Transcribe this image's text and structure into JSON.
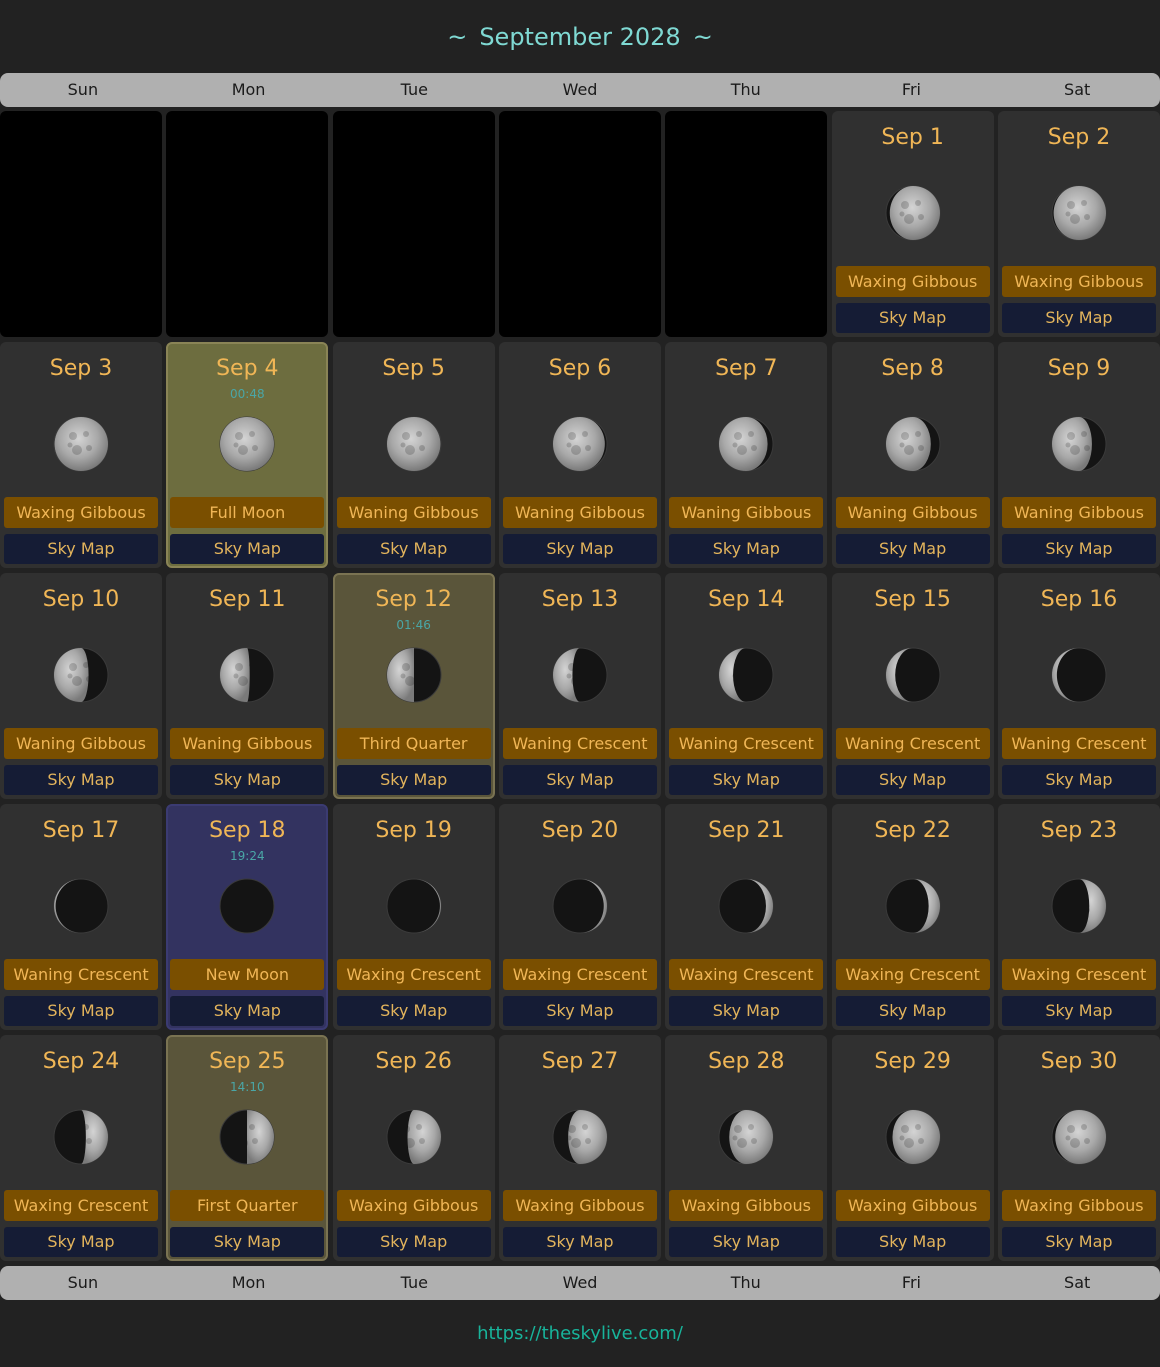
{
  "header": {
    "tilde_left": "~",
    "title": "September 2028",
    "tilde_right": "~"
  },
  "weekdays": [
    "Sun",
    "Mon",
    "Tue",
    "Wed",
    "Thu",
    "Fri",
    "Sat"
  ],
  "first_weekday_index": 5,
  "sky_map_label": "Sky Map",
  "colors": {
    "accent": "#f0b656",
    "title": "#7fd9d3",
    "link": "#18b39a",
    "phase_bg": "#7a4f00",
    "skymap_bg": "#151c35"
  },
  "days": [
    {
      "date": "Sep 1",
      "phase": "Waxing Gibbous",
      "illum": 0.93,
      "waxing": true
    },
    {
      "date": "Sep 2",
      "phase": "Waxing Gibbous",
      "illum": 0.97,
      "waxing": true
    },
    {
      "date": "Sep 3",
      "phase": "Waxing Gibbous",
      "illum": 0.99,
      "waxing": true
    },
    {
      "date": "Sep 4",
      "phase": "Full Moon",
      "time": "00:48",
      "illum": 1.0,
      "waxing": true,
      "highlight": "gold"
    },
    {
      "date": "Sep 5",
      "phase": "Waning Gibbous",
      "illum": 0.99,
      "waxing": false
    },
    {
      "date": "Sep 6",
      "phase": "Waning Gibbous",
      "illum": 0.96,
      "waxing": false
    },
    {
      "date": "Sep 7",
      "phase": "Waning Gibbous",
      "illum": 0.9,
      "waxing": false
    },
    {
      "date": "Sep 8",
      "phase": "Waning Gibbous",
      "illum": 0.83,
      "waxing": false
    },
    {
      "date": "Sep 9",
      "phase": "Waning Gibbous",
      "illum": 0.74,
      "waxing": false
    },
    {
      "date": "Sep 10",
      "phase": "Waning Gibbous",
      "illum": 0.64,
      "waxing": false
    },
    {
      "date": "Sep 11",
      "phase": "Waning Gibbous",
      "illum": 0.55,
      "waxing": false
    },
    {
      "date": "Sep 12",
      "phase": "Third Quarter",
      "time": "01:46",
      "illum": 0.5,
      "waxing": false,
      "highlight": "olive"
    },
    {
      "date": "Sep 13",
      "phase": "Waning Crescent",
      "illum": 0.36,
      "waxing": false
    },
    {
      "date": "Sep 14",
      "phase": "Waning Crescent",
      "illum": 0.26,
      "waxing": false
    },
    {
      "date": "Sep 15",
      "phase": "Waning Crescent",
      "illum": 0.17,
      "waxing": false
    },
    {
      "date": "Sep 16",
      "phase": "Waning Crescent",
      "illum": 0.09,
      "waxing": false
    },
    {
      "date": "Sep 17",
      "phase": "Waning Crescent",
      "illum": 0.03,
      "waxing": false
    },
    {
      "date": "Sep 18",
      "phase": "New Moon",
      "time": "19:24",
      "illum": 0.0,
      "waxing": true,
      "highlight": "blue"
    },
    {
      "date": "Sep 19",
      "phase": "Waxing Crescent",
      "illum": 0.02,
      "waxing": true
    },
    {
      "date": "Sep 20",
      "phase": "Waxing Crescent",
      "illum": 0.06,
      "waxing": true
    },
    {
      "date": "Sep 21",
      "phase": "Waxing Crescent",
      "illum": 0.13,
      "waxing": true
    },
    {
      "date": "Sep 22",
      "phase": "Waxing Crescent",
      "illum": 0.21,
      "waxing": true
    },
    {
      "date": "Sep 23",
      "phase": "Waxing Crescent",
      "illum": 0.31,
      "waxing": true
    },
    {
      "date": "Sep 24",
      "phase": "Waxing Crescent",
      "illum": 0.41,
      "waxing": true
    },
    {
      "date": "Sep 25",
      "phase": "First Quarter",
      "time": "14:10",
      "illum": 0.5,
      "waxing": true,
      "highlight": "olive"
    },
    {
      "date": "Sep 26",
      "phase": "Waxing Gibbous",
      "illum": 0.62,
      "waxing": true
    },
    {
      "date": "Sep 27",
      "phase": "Waxing Gibbous",
      "illum": 0.72,
      "waxing": true
    },
    {
      "date": "Sep 28",
      "phase": "Waxing Gibbous",
      "illum": 0.81,
      "waxing": true
    },
    {
      "date": "Sep 29",
      "phase": "Waxing Gibbous",
      "illum": 0.88,
      "waxing": true
    },
    {
      "date": "Sep 30",
      "phase": "Waxing Gibbous",
      "illum": 0.94,
      "waxing": true
    }
  ],
  "footer": {
    "link": "https://theskylive.com/"
  }
}
